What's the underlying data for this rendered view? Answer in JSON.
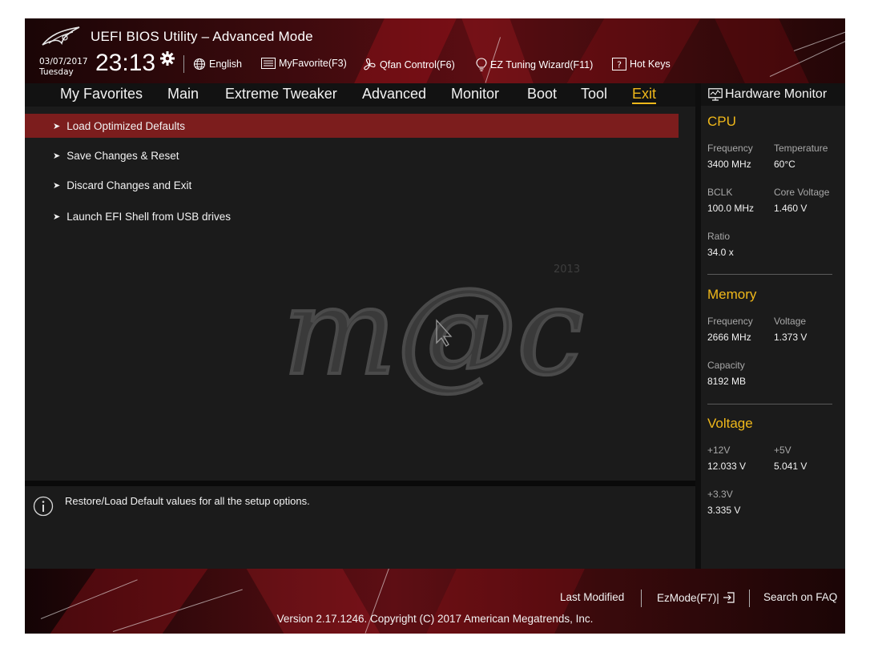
{
  "header": {
    "title": "UEFI BIOS Utility – Advanced Mode",
    "date": "03/07/2017",
    "day": "Tuesday",
    "time": "23:13",
    "toolbar": [
      {
        "label": "English",
        "icon": "globe-icon"
      },
      {
        "label": "MyFavorite(F3)",
        "icon": "favorite-list-icon"
      },
      {
        "label": "Qfan Control(F6)",
        "icon": "fan-icon"
      },
      {
        "label": "EZ Tuning Wizard(F11)",
        "icon": "lightbulb-icon"
      },
      {
        "label": "Hot Keys",
        "icon": "question-box-icon"
      }
    ]
  },
  "nav": {
    "tabs": [
      "My Favorites",
      "Main",
      "Extreme Tweaker",
      "Advanced",
      "Monitor",
      "Boot",
      "Tool",
      "Exit"
    ],
    "active": "Exit"
  },
  "menu": {
    "items": [
      {
        "label": "Load Optimized Defaults",
        "selected": true
      },
      {
        "label": "Save Changes & Reset",
        "selected": false
      },
      {
        "label": "Discard Changes and Exit",
        "selected": false
      },
      {
        "label": "Launch EFI Shell from USB drives",
        "selected": false
      }
    ]
  },
  "watermark": {
    "text": "m@c",
    "year": "2013"
  },
  "help": {
    "text": "Restore/Load Default values for all the setup options."
  },
  "hardware_monitor": {
    "title": "Hardware Monitor",
    "cpu": {
      "title": "CPU",
      "frequency_label": "Frequency",
      "frequency": "3400 MHz",
      "temperature_label": "Temperature",
      "temperature": "60°C",
      "bclk_label": "BCLK",
      "bclk": "100.0 MHz",
      "core_voltage_label": "Core Voltage",
      "core_voltage": "1.460 V",
      "ratio_label": "Ratio",
      "ratio": "34.0 x"
    },
    "memory": {
      "title": "Memory",
      "frequency_label": "Frequency",
      "frequency": "2666 MHz",
      "voltage_label": "Voltage",
      "voltage": "1.373 V",
      "capacity_label": "Capacity",
      "capacity": "8192 MB"
    },
    "voltage": {
      "title": "Voltage",
      "v12_label": "+12V",
      "v12": "12.033 V",
      "v5_label": "+5V",
      "v5": "5.041 V",
      "v33_label": "+3.3V",
      "v33": "3.335 V"
    }
  },
  "footer": {
    "last_modified": "Last Modified",
    "ezmode": "EzMode(F7)|",
    "search_faq": "Search on FAQ",
    "copyright": "Version 2.17.1246. Copyright (C) 2017 American Megatrends, Inc."
  },
  "colors": {
    "accent": "#f0b81a",
    "selected_row": "#7c1d1d",
    "background": "#1b1b1b",
    "header_red": "#5a0d12"
  }
}
